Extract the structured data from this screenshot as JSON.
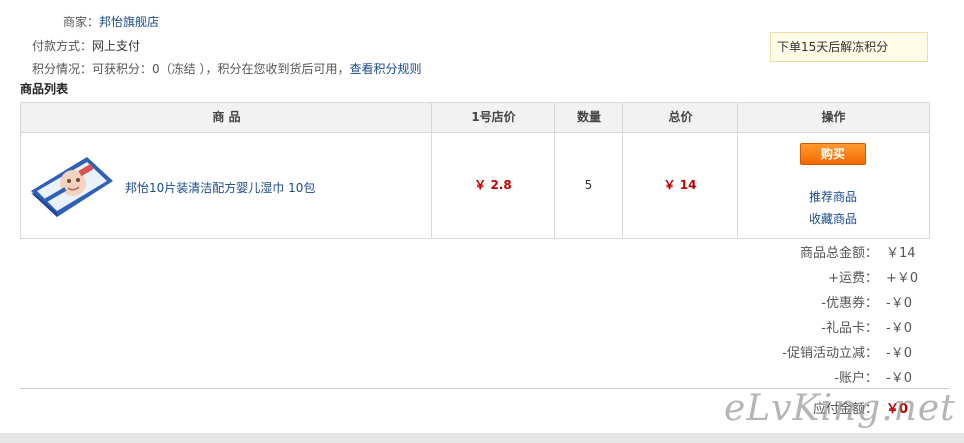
{
  "merchant": {
    "label": "商家：",
    "value": "邦怡旗舰店"
  },
  "payment": {
    "label": "付款方式：",
    "value": "网上支付"
  },
  "points": {
    "label": "积分情况：可获积分：0（冻结  ），积分在您收到货后可用，",
    "link": "查看积分规则"
  },
  "notice": "下单15天后解冻积分",
  "section_title": "商品列表",
  "table": {
    "headers": [
      "商 品",
      "1号店价",
      "数量",
      "总价",
      "操作"
    ],
    "row": {
      "product_name": "邦怡10片装清洁配方婴儿湿巾 10包",
      "unit_price": "￥ 2.8",
      "quantity": "5",
      "total": "￥ 14",
      "buy_label": "购买",
      "recommend_label": "推荐商品",
      "favorite_label": "收藏商品"
    }
  },
  "summary": [
    {
      "label": "商品总金额：",
      "value": "￥14"
    },
    {
      "label": "+运费：",
      "value": "+￥0"
    },
    {
      "label": "-优惠券：",
      "value": "-￥0"
    },
    {
      "label": "-礼品卡：",
      "value": "-￥0"
    },
    {
      "label": "-促销活动立减：",
      "value": "-￥0"
    },
    {
      "label": "-账户：",
      "value": "-￥0"
    }
  ],
  "total_due": {
    "label": "应付金额：",
    "value": "￥0"
  },
  "watermark": "eLvKing.net",
  "colors": {
    "link": "#1a4a8a",
    "price": "#c00000",
    "button": "#f07a10",
    "notice_bg": "#fffbe6"
  }
}
